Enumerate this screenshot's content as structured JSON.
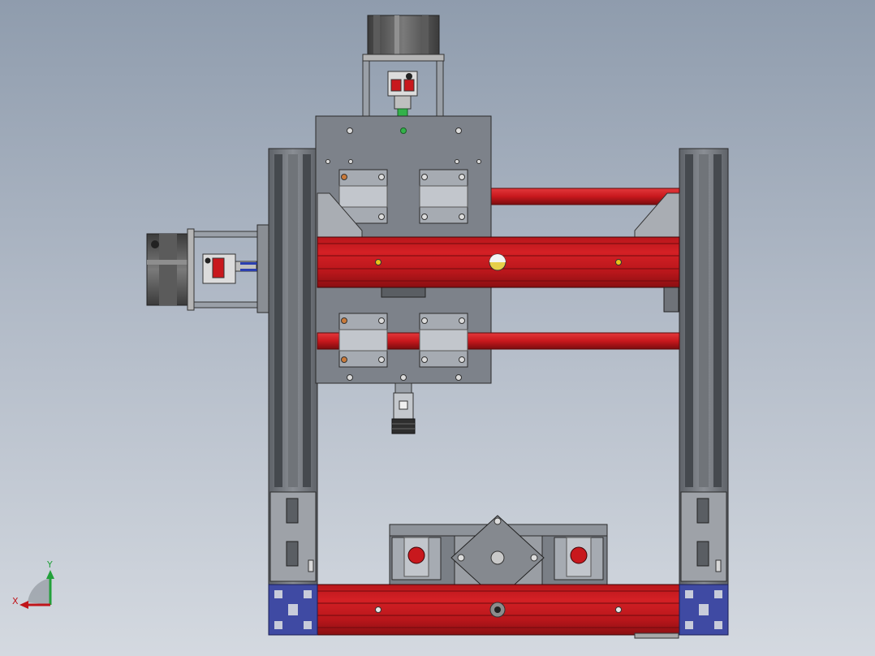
{
  "viewport": {
    "background_top": "#8f9cad",
    "background_bottom": "#d4d9e0"
  },
  "colors": {
    "rail_red": "#c8181d",
    "rail_red_dark": "#7a0c0f",
    "plate_grey": "#8a8f98",
    "frame_grey": "#6b6f75",
    "corner_blue": "#3f4aa3",
    "motor_dark": "#4a4a4a"
  },
  "triad": {
    "x_label": "X",
    "y_label": "Y",
    "x_color": "#c0151a",
    "y_color": "#22a03a"
  }
}
